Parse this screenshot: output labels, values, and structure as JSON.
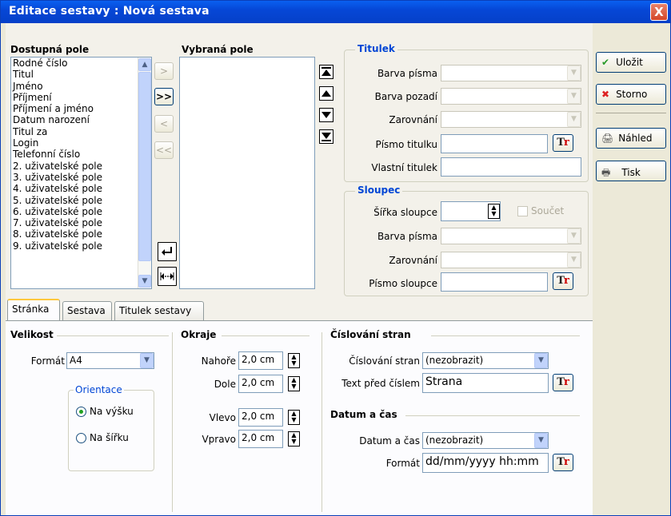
{
  "window": {
    "title": "Editace sestavy : Nová sestava",
    "close": "X"
  },
  "available_fields": {
    "label": "Dostupná pole",
    "items": [
      "Rodné číslo",
      "Titul",
      "Jméno",
      "Příjmení",
      "Příjmení a jméno",
      "Datum narození",
      "Titul za",
      "Login",
      "Telefonní číslo",
      "2. uživatelské pole",
      "3. uživatelské pole",
      "4. uživatelské pole",
      "5. uživatelské pole",
      "6. uživatelské pole",
      "7. uživatelské pole",
      "8. uživatelské pole",
      "9. uživatelské pole"
    ]
  },
  "selected_fields": {
    "label": "Vybraná pole",
    "items": []
  },
  "transfer_buttons": {
    "add": ">",
    "add_all": ">>",
    "remove": "<",
    "remove_all": "<<"
  },
  "title_group": {
    "label": "Titulek",
    "font_color_label": "Barva písma",
    "bg_color_label": "Barva pozadí",
    "align_label": "Zarovnání",
    "font_label": "Písmo titulku",
    "custom_title_label": "Vlastní titulek",
    "font_color_value": "",
    "bg_color_value": "",
    "align_value": "",
    "font_value": "",
    "custom_title_value": ""
  },
  "column_group": {
    "label": "Sloupec",
    "width_label": "Šířka sloupce",
    "width_value": "",
    "sum_label": "Součet",
    "font_color_label": "Barva písma",
    "align_label": "Zarovnání",
    "font_label": "Písmo sloupce"
  },
  "side_buttons": {
    "save": "Uložit",
    "cancel": "Storno",
    "preview": "Náhled",
    "print": "Tisk"
  },
  "tabs": [
    "Stránka",
    "Sestava",
    "Titulek sestavy"
  ],
  "page_tab": {
    "size": {
      "title": "Velikost",
      "format_label": "Formát",
      "format_value": "A4"
    },
    "orientation": {
      "title": "Orientace",
      "portrait": "Na výšku",
      "landscape": "Na šířku",
      "selected": "portrait"
    },
    "margins": {
      "title": "Okraje",
      "top_label": "Nahoře",
      "top_value": "2,0 cm",
      "bottom_label": "Dole",
      "bottom_value": "2,0 cm",
      "left_label": "Vlevo",
      "left_value": "2,0 cm",
      "right_label": "Vpravo",
      "right_value": "2,0 cm"
    },
    "numbering": {
      "title": "Číslování stran",
      "numbering_label": "Číslování stran",
      "numbering_value": "(nezobrazit)",
      "text_before_label": "Text před číslem",
      "text_before_value": "Strana"
    },
    "datetime": {
      "title": "Datum a čas",
      "datetime_label": "Datum a čas",
      "datetime_value": "(nezobrazit)",
      "format_label": "Formát",
      "format_value": "dd/mm/yyyy hh:mm"
    }
  },
  "font_button": "Tr"
}
